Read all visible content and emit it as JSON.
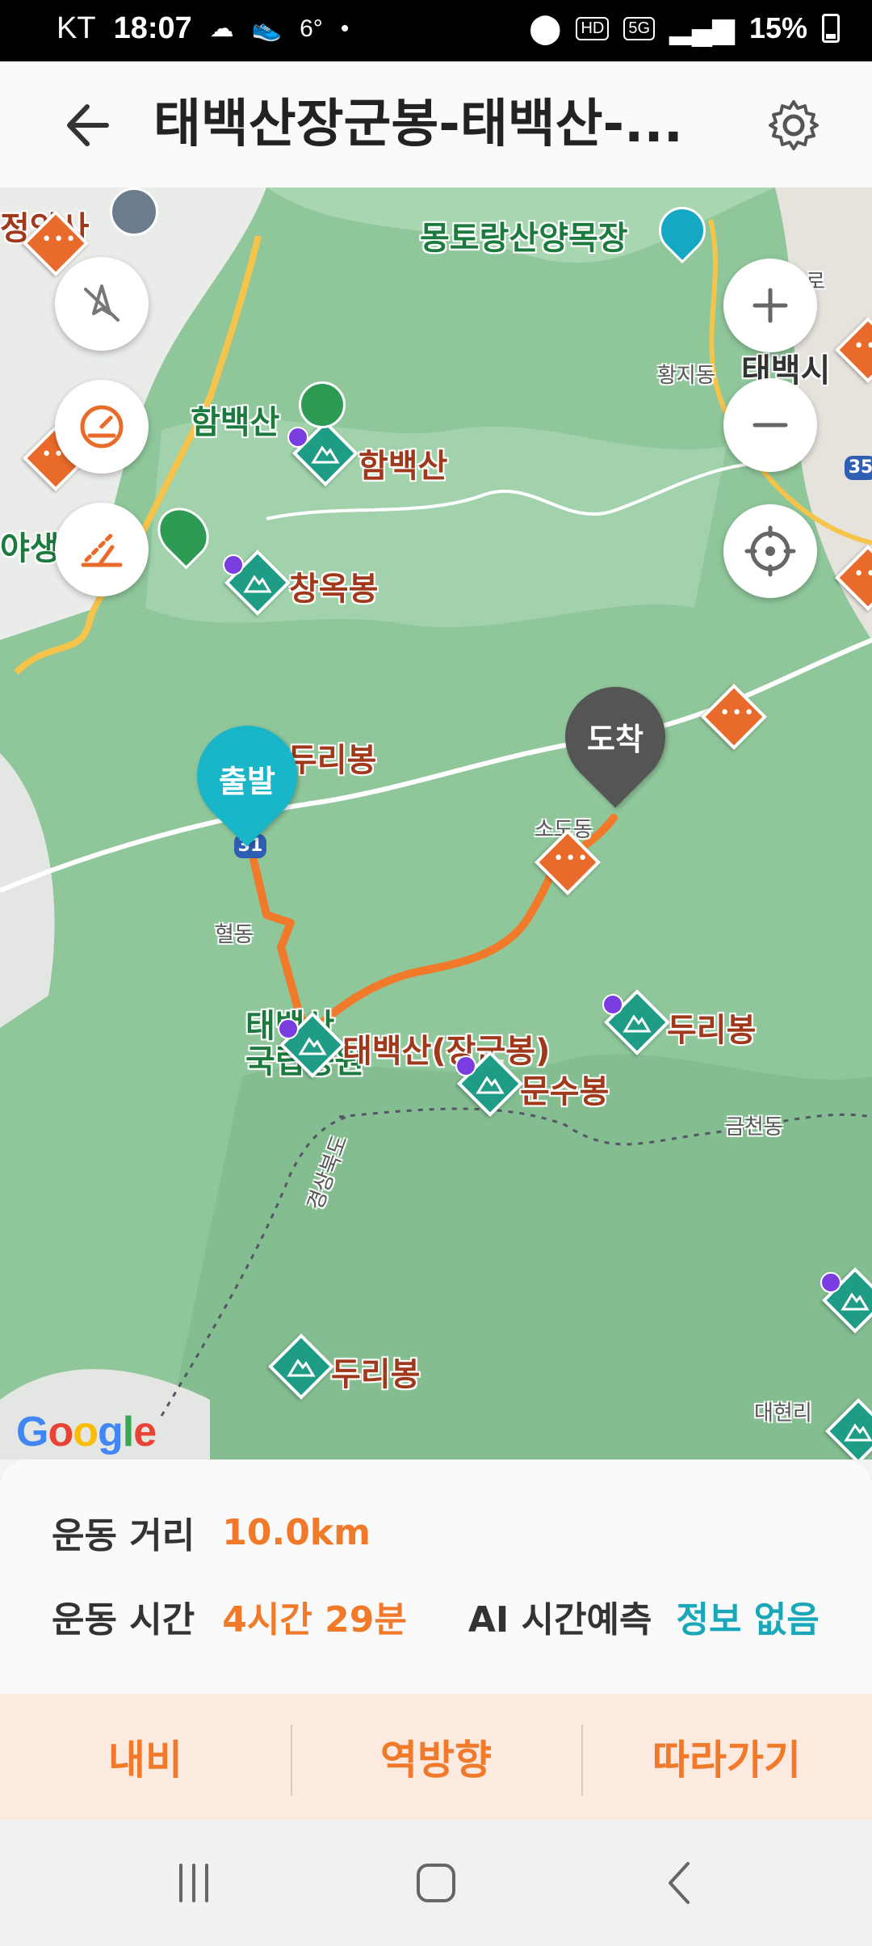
{
  "status": {
    "carrier": "KT",
    "time": "18:07",
    "temp": "6°",
    "dot": "•",
    "hd": "HD",
    "net": "5G",
    "battery": "15%"
  },
  "header": {
    "title": "태백산장군봉-태백산-...",
    "back_icon": "arrow-left-icon",
    "settings_icon": "gear-icon"
  },
  "map": {
    "labels": {
      "jeongamsa": "정암사",
      "mongto": "몽토랑산양목장",
      "hambaeksan_green": "함백산",
      "hambaeksan": "함백산",
      "changokbong": "창옥봉",
      "yasaeng": "야생화",
      "hwangji": "황지동",
      "taebaeksi": "태백시",
      "road_tag": "로",
      "duribong1": "두리봉",
      "sodo": "소도동",
      "hyeol": "혈동",
      "taebaek_park": "태백산 국립공원",
      "janggun": "태백산(장군봉)",
      "munsu": "문수봉",
      "duribong2": "두리봉",
      "geumcheon": "금천동",
      "gyeongbuk": "경상북도",
      "duribong3": "두리봉",
      "daehyeon": "대현리",
      "route_no": "31",
      "route_no2": "35"
    },
    "start_pin": "출발",
    "end_pin": "도착",
    "google": "Google",
    "accent": "#f07a2a",
    "peak_color": "#1f9c85",
    "start_color": "#19b5c8",
    "end_color": "#555555"
  },
  "info": {
    "distance_label": "운동 거리",
    "distance_value": "10.0km",
    "time_label": "운동 시간",
    "time_value": "4시간 29분",
    "ai_label": "AI 시간예측",
    "ai_value": "정보 없음"
  },
  "actions": {
    "navi": "내비",
    "reverse": "역방향",
    "follow": "따라가기"
  }
}
